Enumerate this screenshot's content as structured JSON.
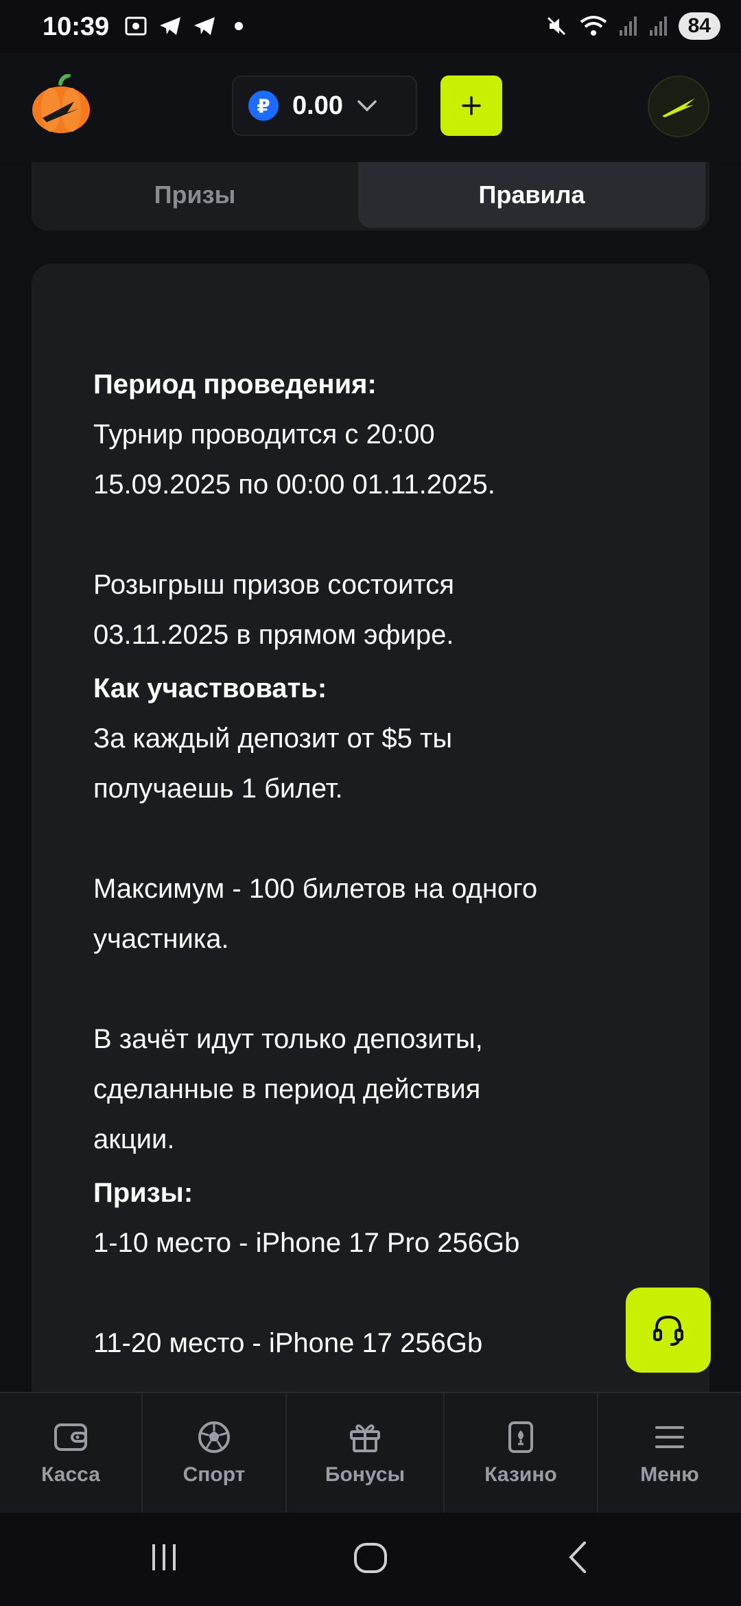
{
  "status_bar": {
    "time": "10:39",
    "battery": "84"
  },
  "header": {
    "balance": "0.00",
    "currency_symbol": "₽",
    "add_label": "+"
  },
  "tabs": [
    {
      "label": "Призы",
      "active": false
    },
    {
      "label": "Правила",
      "active": true
    }
  ],
  "rules": {
    "period_heading": "Период проведения:",
    "period_line1": "Турнир проводится с 20:00",
    "period_line2": "15.09.2025 по 00:00 01.11.2025.",
    "draw_line1": "Розыгрыш призов состоится",
    "draw_line2": "03.11.2025 в прямом эфире.",
    "how_heading": "Как участвовать:",
    "how_line1": "За каждый депозит от $5 ты",
    "how_line2": "получаешь 1 билет.",
    "max_line1": "Максимум - 100 билетов на одного",
    "max_line2": "участника.",
    "dep_line1": "В зачёт идут только депозиты,",
    "dep_line2": "сделанные в период действия",
    "dep_line3": "акции.",
    "prizes_heading": "Призы:",
    "prize1": "1-10 место - iPhone 17 Pro 256Gb",
    "prize2": "11-20 место - iPhone 17 256Gb"
  },
  "bottom_nav": [
    {
      "label": "Касса",
      "icon": "wallet-icon"
    },
    {
      "label": "Спорт",
      "icon": "soccer-ball-icon"
    },
    {
      "label": "Бонусы",
      "icon": "gift-icon"
    },
    {
      "label": "Казино",
      "icon": "casino-card-icon"
    },
    {
      "label": "Меню",
      "icon": "menu-icon"
    }
  ],
  "colors": {
    "accent": "#c8f000",
    "background": "#0f1013",
    "card": "#1b1c20",
    "ruble": "#1c6cff"
  }
}
